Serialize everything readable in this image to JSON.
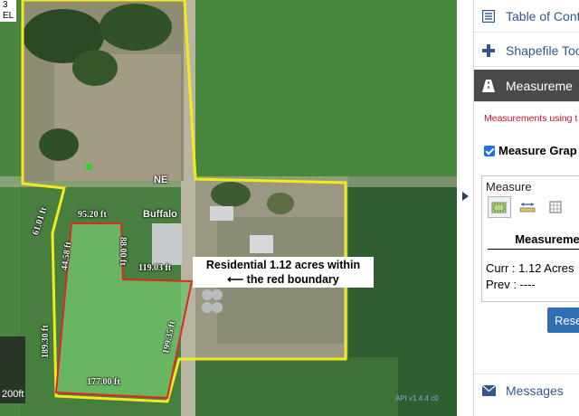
{
  "map": {
    "scale_box": {
      "line1": "3",
      "line2": "EL"
    },
    "scale_label": "200ft",
    "attribution": "API v1.4.4 c0",
    "places": {
      "ne": "NE",
      "buffalo": "Buffalo"
    },
    "measurements": {
      "m1": "95.20 ft",
      "m2": "61.01 ft",
      "m3": "44.58 ft",
      "m4": "88.00 ft",
      "m5": "119.03 ft",
      "m6": "189.30 ft",
      "m7": "199.35 ft",
      "m8": "177.00 ft"
    },
    "callout": {
      "line1": "Residential 1.12 acres within",
      "line2": "the red boundary"
    },
    "colors": {
      "parcel": "#f2ea1e",
      "residential": "#e02626"
    }
  },
  "panel": {
    "toc_label": "Table of Conte",
    "shapefile_label": "Shapefile Too",
    "measurement_label": "Measureme",
    "warning": "Measurements using t official",
    "measure_graphics_label": "Measure Grap",
    "measure_title": "Measure",
    "measurement_header": "Measureme",
    "curr": "Curr : 1.12 Acres",
    "prev": "Prev : ----",
    "reset_label": "Rese",
    "messages_label": "Messages",
    "tools": {
      "area": "area-tool-icon",
      "distance": "distance-tool-icon",
      "location": "location-tool-icon"
    }
  }
}
